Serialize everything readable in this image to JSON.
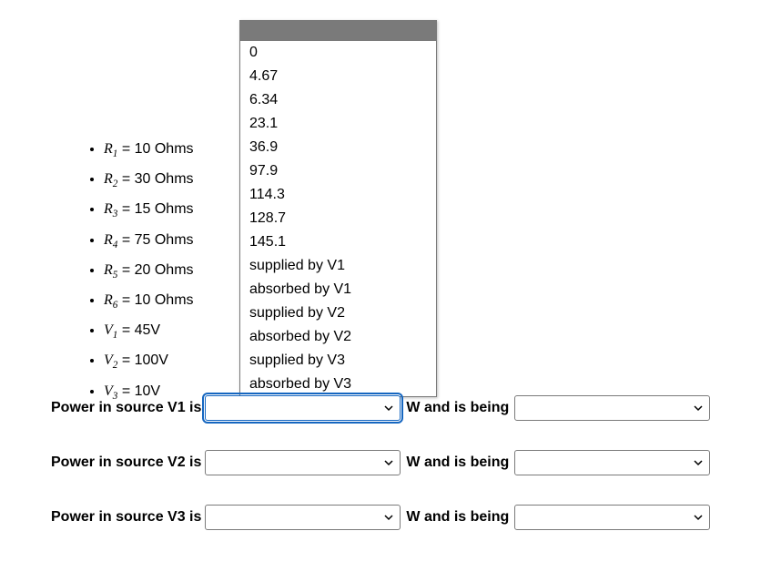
{
  "givens": [
    {
      "sym": "R",
      "sub": "1",
      "eq_text": " = 10 Ohms"
    },
    {
      "sym": "R",
      "sub": "2",
      "eq_text": " = 30 Ohms"
    },
    {
      "sym": "R",
      "sub": "3",
      "eq_text": " = 15 Ohms"
    },
    {
      "sym": "R",
      "sub": "4",
      "eq_text": " = 75 Ohms"
    },
    {
      "sym": "R",
      "sub": "5",
      "eq_text": " = 20 Ohms"
    },
    {
      "sym": "R",
      "sub": "6",
      "eq_text": " = 10 Ohms"
    },
    {
      "sym": "V",
      "sub": "1",
      "eq_text": " = 45V"
    },
    {
      "sym": "V",
      "sub": "2",
      "eq_text": " = 100V"
    },
    {
      "sym": "V",
      "sub": "3",
      "eq_text": " = 10V"
    }
  ],
  "dropdown_options": [
    "0",
    "4.67",
    "6.34",
    "23.1",
    "36.9",
    "97.9",
    "114.3",
    "128.7",
    "145.1",
    "supplied by V1",
    "absorbed by V1",
    "supplied by V2",
    "absorbed by V2",
    "supplied by V3",
    "absorbed by V3"
  ],
  "rows": {
    "r1": {
      "label": "Power in source V1 is",
      "mid": "W and is being"
    },
    "r2": {
      "label": "Power in source V2 is",
      "mid": "W and is being"
    },
    "r3": {
      "label": "Power in source V3 is",
      "mid": "W and is being"
    }
  },
  "selects": {
    "r1_power": {
      "value": ""
    },
    "r1_status": {
      "value": ""
    },
    "r2_power": {
      "value": ""
    },
    "r2_status": {
      "value": ""
    },
    "r3_power": {
      "value": ""
    },
    "r3_status": {
      "value": ""
    }
  }
}
